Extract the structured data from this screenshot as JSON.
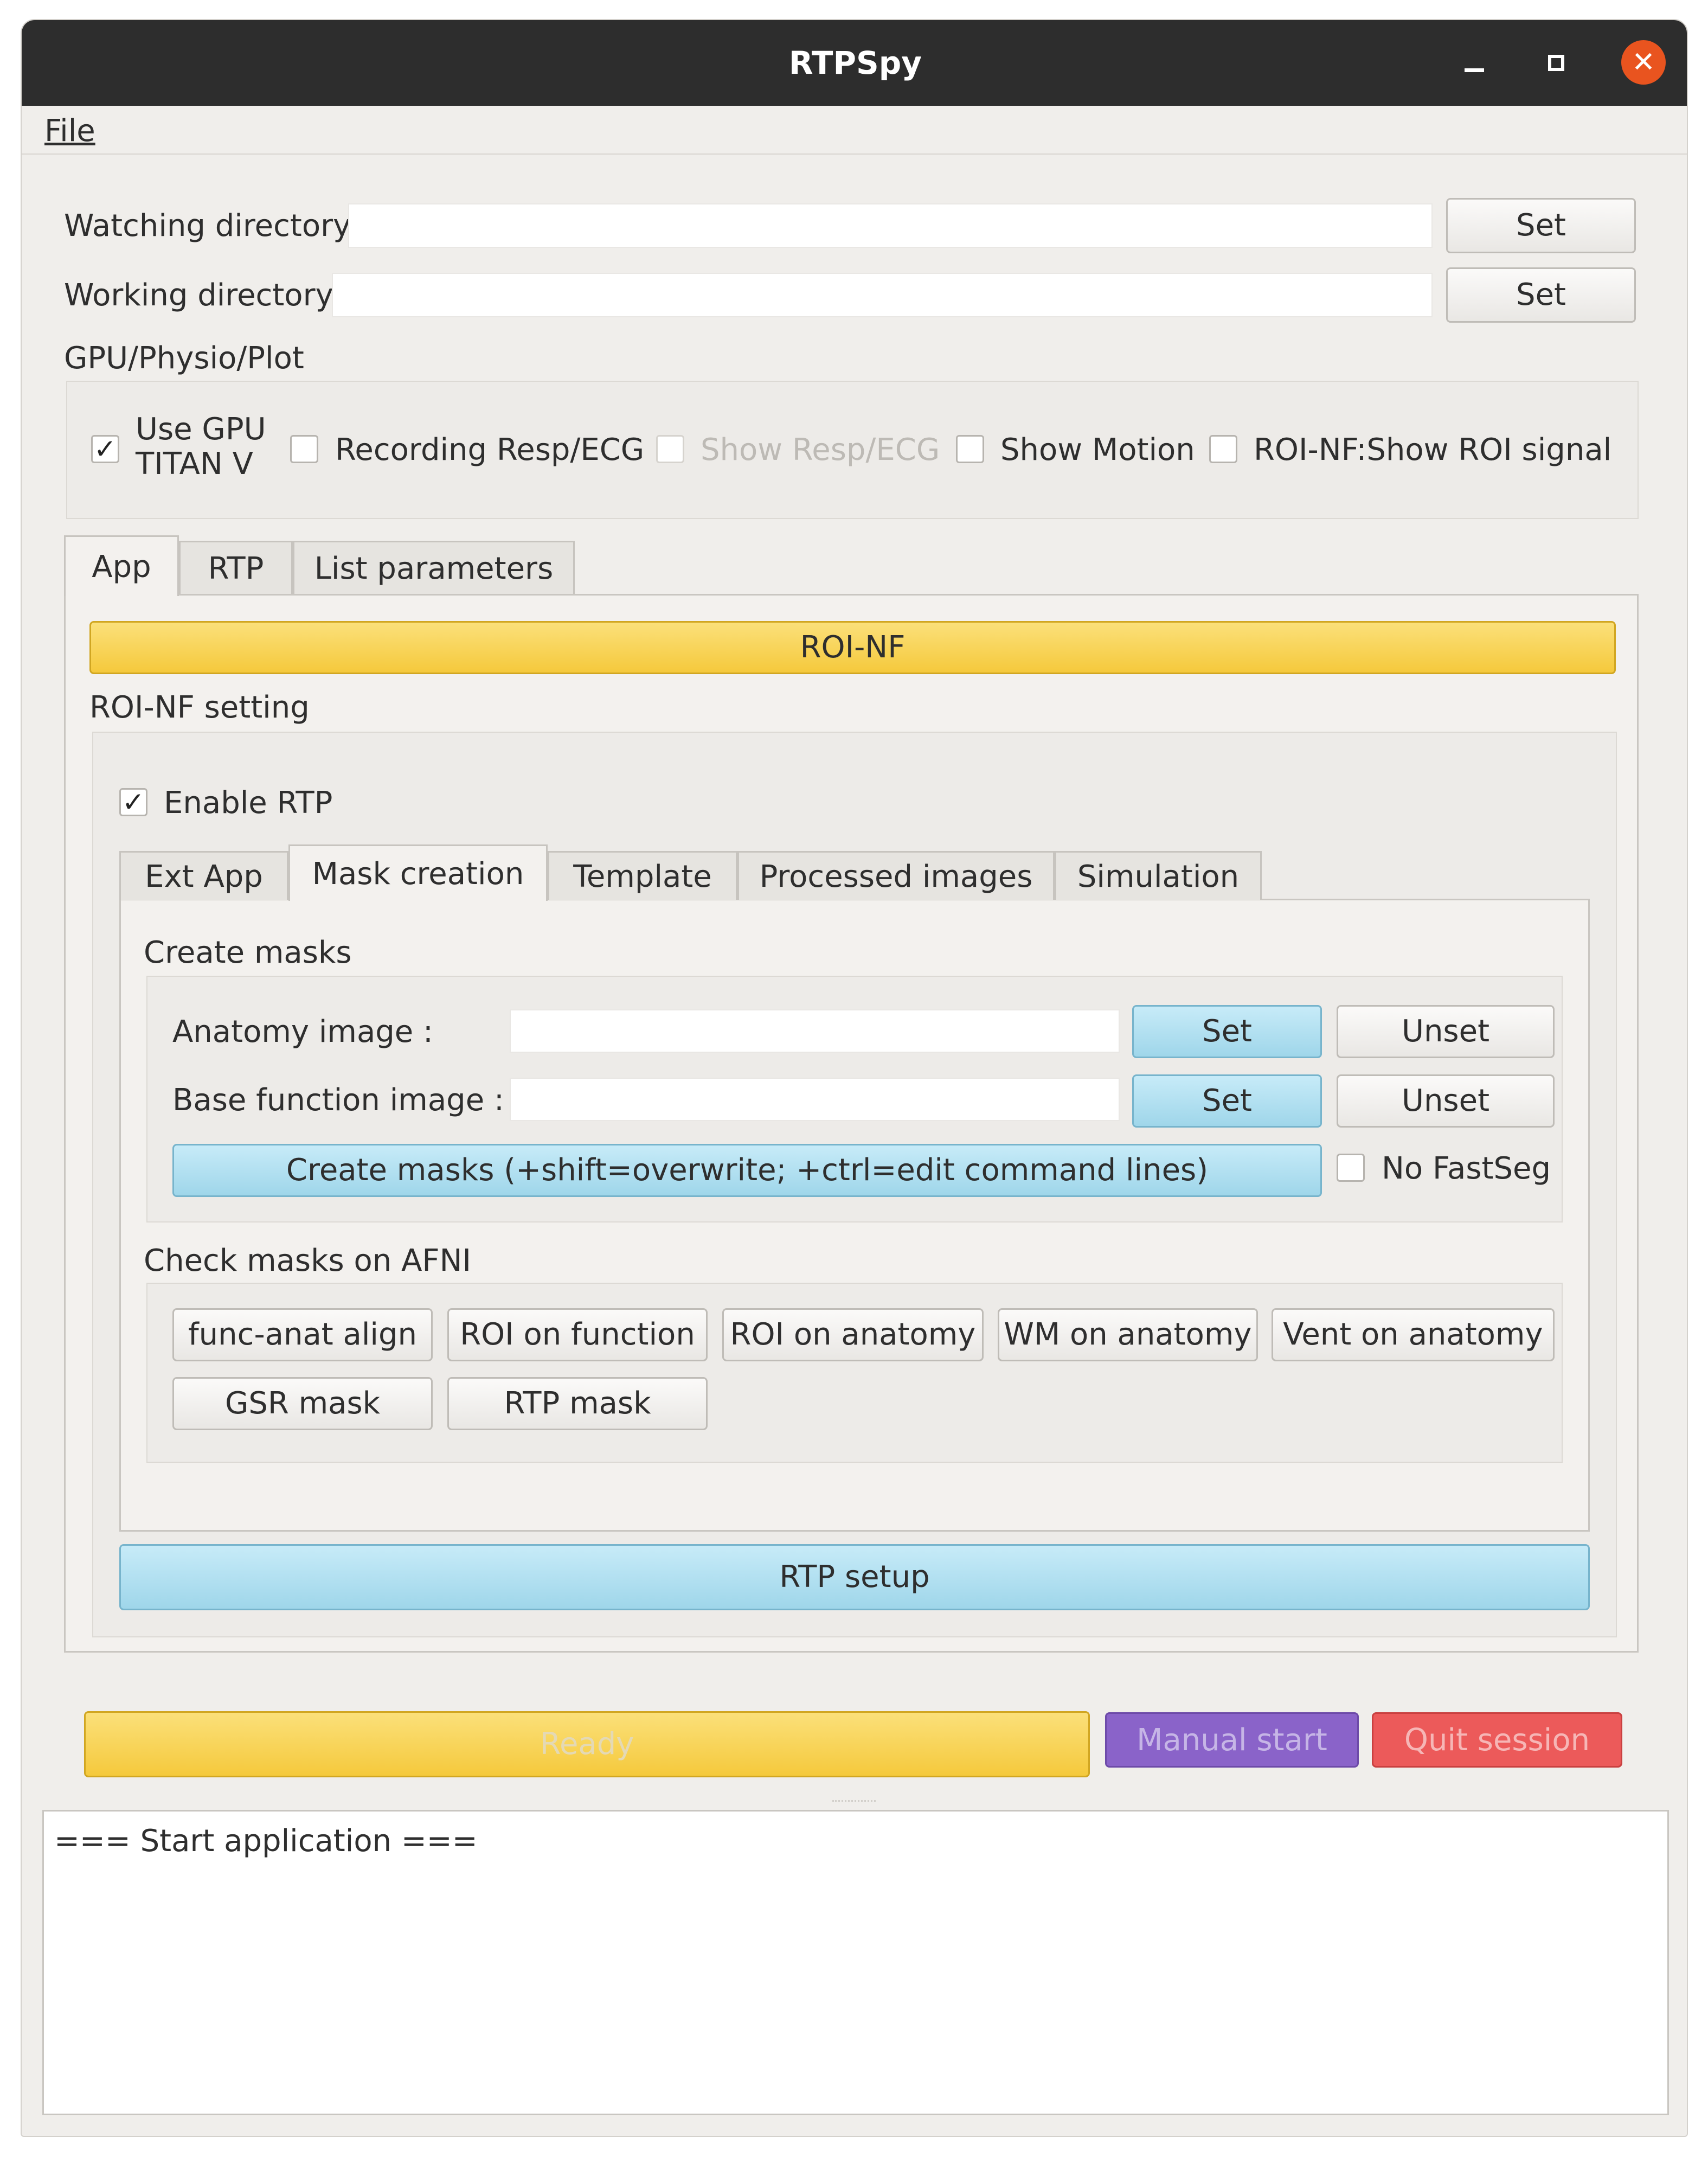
{
  "window": {
    "title": "RTPSpy"
  },
  "title_buttons": {
    "minimize": "–",
    "maximize": "□",
    "close": "✕"
  },
  "menu": {
    "file": "File"
  },
  "dirs": {
    "watching_label": "Watching directory",
    "watching_value": "",
    "working_label": "Working directory",
    "working_value": "",
    "set_label": "Set"
  },
  "gpu_group": {
    "title": "GPU/Physio/Plot",
    "use_gpu_line1": "Use GPU",
    "use_gpu_line2": "TITAN V",
    "use_gpu_checked": true,
    "recording": "Recording Resp/ECG",
    "show_resp": "Show Resp/ECG",
    "show_motion": "Show Motion",
    "roi_signal": "ROI-NF:Show ROI signal"
  },
  "main_tabs": [
    "App",
    "RTP",
    "List parameters"
  ],
  "roi_nf_button": "ROI-NF",
  "roi_nf_setting": {
    "title": "ROI-NF setting",
    "enable_rtp": "Enable RTP",
    "enable_checked": true
  },
  "sub_tabs": [
    "Ext App",
    "Mask creation",
    "Template",
    "Processed images",
    "Simulation"
  ],
  "create_masks": {
    "title": "Create masks",
    "anatomy_label": "Anatomy image :",
    "base_label": "Base function image :",
    "set": "Set",
    "unset": "Unset",
    "create_button": "Create masks (+shift=overwrite; +ctrl=edit command lines)",
    "no_fastseg": "No FastSeg"
  },
  "check_masks": {
    "title": "Check masks on AFNI",
    "buttons": [
      "func-anat align",
      "ROI on function",
      "ROI on anatomy",
      "WM on anatomy",
      "Vent on anatomy",
      "GSR mask",
      "RTP mask"
    ]
  },
  "rtp_setup": "RTP setup",
  "bottom": {
    "ready": "Ready",
    "manual_start": "Manual start",
    "quit_session": "Quit session"
  },
  "log_text": "=== Start application ===",
  "colors": {
    "yellow": "#f5c93c",
    "blue": "#a6d9ec",
    "purple": "#8a63c9",
    "red": "#ec5a5a",
    "close_orange": "#e9541f"
  }
}
